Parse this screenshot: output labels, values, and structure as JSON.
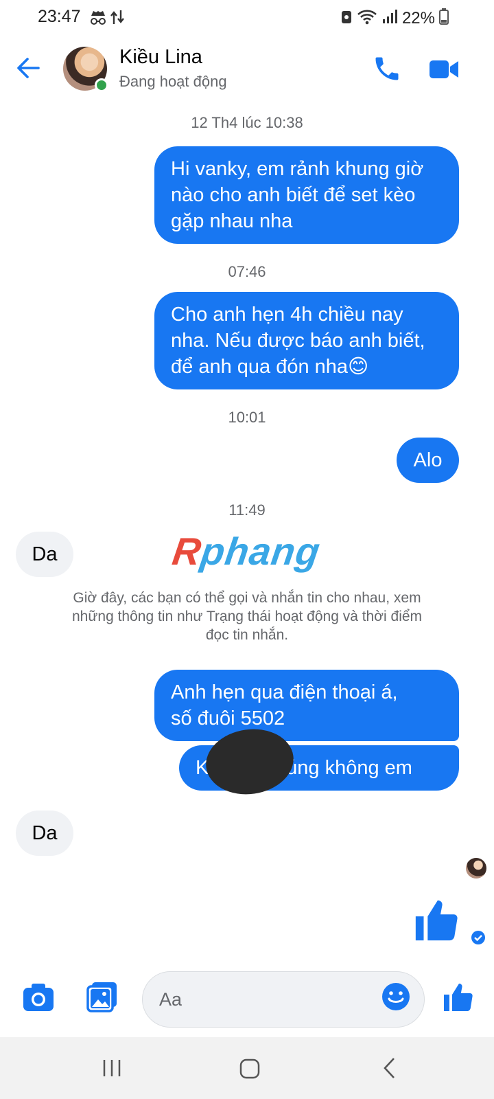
{
  "status_bar": {
    "time": "23:47",
    "battery_percent": "22%",
    "icons": [
      "incognito-icon",
      "data-transfer-icon",
      "vpn-key-icon",
      "wifi-icon",
      "signal-icon",
      "battery-icon"
    ]
  },
  "header": {
    "contact_name": "Kiều Lina",
    "contact_status": "Đang hoạt động",
    "online": true
  },
  "messages": {
    "ts1": "12 Th4 lúc 10:38",
    "msg1": [
      "Hi vanky, em rảnh khung giờ",
      "nào cho anh biết để set kèo",
      "gặp nhau nha"
    ],
    "ts2": "07:46",
    "msg2": [
      "Cho anh hẹn 4h chiều nay",
      "nha. Nếu được báo anh biết,",
      "để anh qua đón nha😊"
    ],
    "ts3": "10:01",
    "msg3": "Alo",
    "ts4": "11:49",
    "msg4": "Da",
    "info": [
      "Giờ đây, các bạn có thể gọi và nhắn tin cho nhau, xem",
      "những thông tin như Trạng thái hoạt động và thời điểm",
      "đọc tin nhắn."
    ],
    "msg5": [
      "Anh hẹn qua điện thoại á,",
      "số đuôi 5502"
    ],
    "msg6": "K            đúng không em",
    "msg7": "Da"
  },
  "watermark": {
    "first_letter": "R",
    "rest": "phang"
  },
  "composer": {
    "placeholder": "Aa"
  },
  "colors": {
    "accent": "#1877f2",
    "online": "#31a24c",
    "incoming_bubble": "#f0f2f5"
  }
}
